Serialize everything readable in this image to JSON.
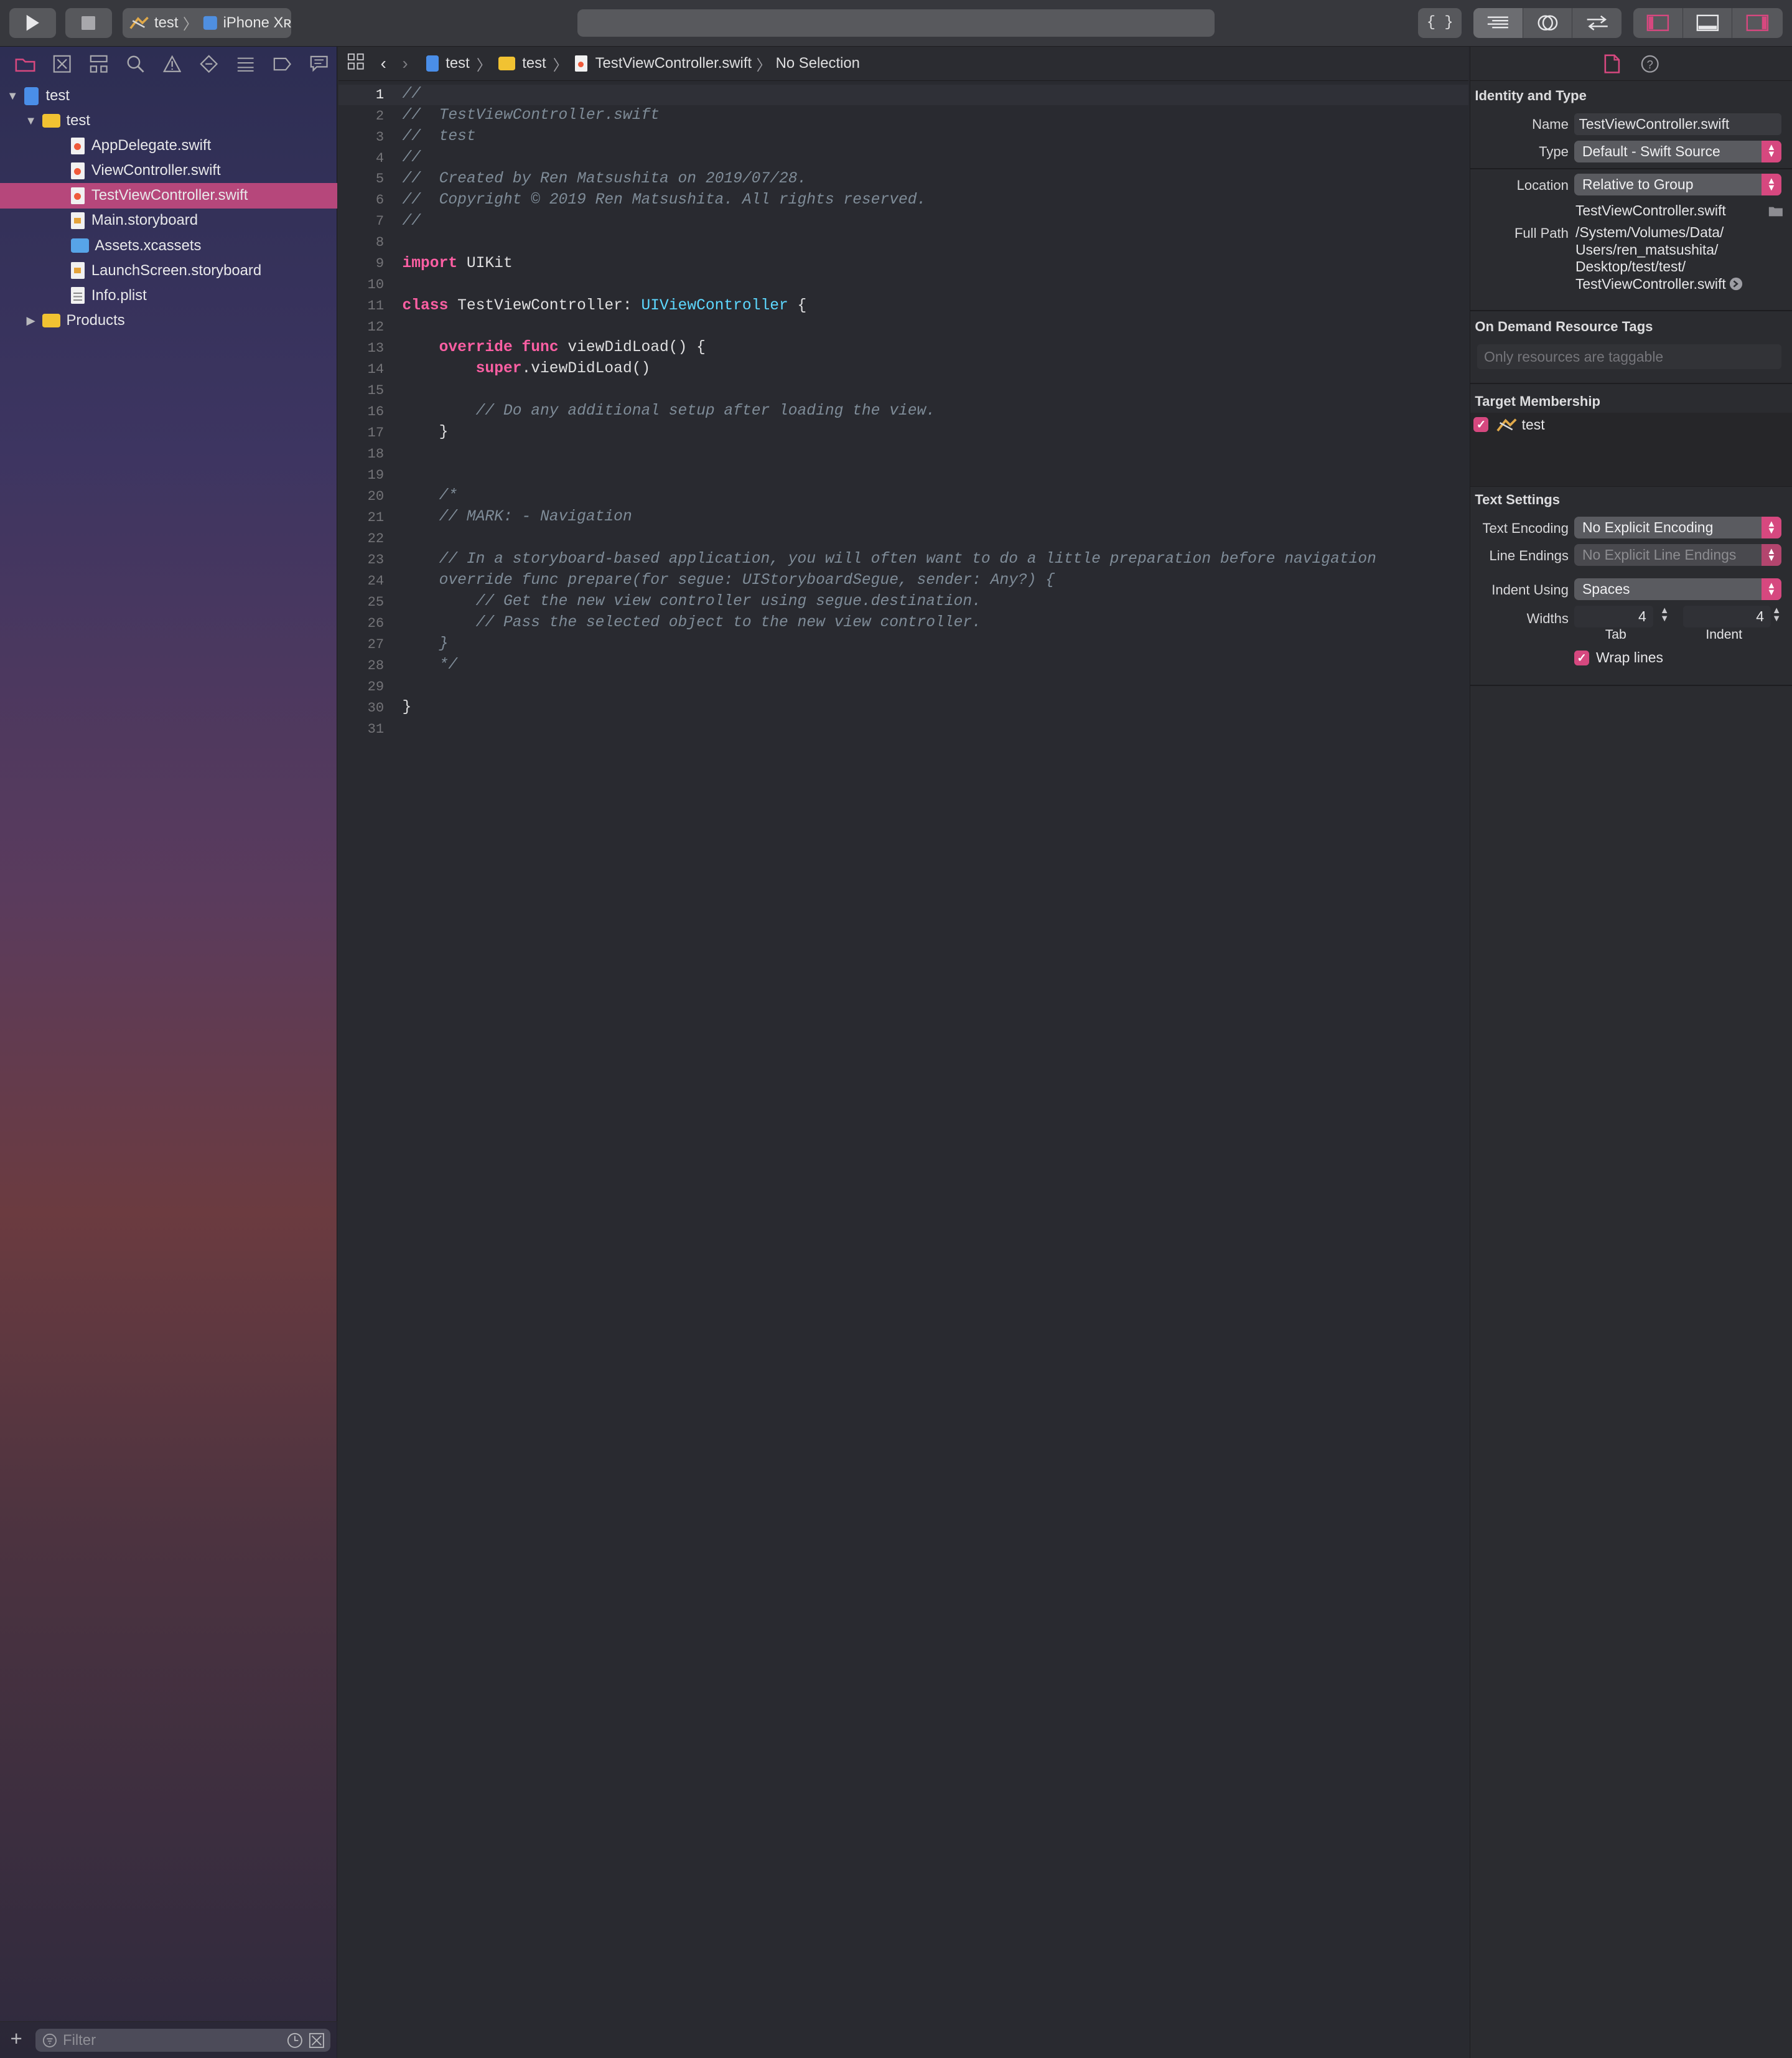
{
  "toolbar": {
    "scheme_target": "test",
    "scheme_device": "iPhone Xʀ"
  },
  "navigator": {
    "tree": [
      {
        "label": "test",
        "indent": 0,
        "kind": "project",
        "expanded": true
      },
      {
        "label": "test",
        "indent": 1,
        "kind": "folder",
        "expanded": true
      },
      {
        "label": "AppDelegate.swift",
        "indent": 2,
        "kind": "swift"
      },
      {
        "label": "ViewController.swift",
        "indent": 2,
        "kind": "swift"
      },
      {
        "label": "TestViewController.swift",
        "indent": 2,
        "kind": "swift",
        "selected": true
      },
      {
        "label": "Main.storyboard",
        "indent": 2,
        "kind": "storyboard"
      },
      {
        "label": "Assets.xcassets",
        "indent": 2,
        "kind": "assets"
      },
      {
        "label": "LaunchScreen.storyboard",
        "indent": 2,
        "kind": "storyboard"
      },
      {
        "label": "Info.plist",
        "indent": 2,
        "kind": "plist"
      },
      {
        "label": "Products",
        "indent": 1,
        "kind": "folder",
        "expanded": false
      }
    ],
    "filter_placeholder": "Filter"
  },
  "jumpbar": {
    "project": "test",
    "group": "test",
    "file": "TestViewController.swift",
    "selection": "No Selection"
  },
  "editor": {
    "current_line": 1,
    "lines": [
      [
        [
          "cm",
          "//"
        ]
      ],
      [
        [
          "cm",
          "//  TestViewController.swift"
        ]
      ],
      [
        [
          "cm",
          "//  test"
        ]
      ],
      [
        [
          "cm",
          "//"
        ]
      ],
      [
        [
          "cm",
          "//  Created by Ren Matsushita on 2019/07/28."
        ]
      ],
      [
        [
          "cm",
          "//  Copyright © 2019 Ren Matsushita. All rights reserved."
        ]
      ],
      [
        [
          "cm",
          "//"
        ]
      ],
      [],
      [
        [
          "kw",
          "import"
        ],
        [
          "pl",
          " UIKit"
        ]
      ],
      [],
      [
        [
          "kw",
          "class"
        ],
        [
          "pl",
          " TestViewController: "
        ],
        [
          "ty",
          "UIViewController"
        ],
        [
          "pl",
          " {"
        ]
      ],
      [],
      [
        [
          "pl",
          "    "
        ],
        [
          "kw",
          "override"
        ],
        [
          "pl",
          " "
        ],
        [
          "kw",
          "func"
        ],
        [
          "pl",
          " viewDidLoad() {"
        ]
      ],
      [
        [
          "pl",
          "        "
        ],
        [
          "kw",
          "super"
        ],
        [
          "pl",
          ".viewDidLoad()"
        ]
      ],
      [],
      [
        [
          "pl",
          "        "
        ],
        [
          "cm",
          "// Do any additional setup after loading the view."
        ]
      ],
      [
        [
          "pl",
          "    }"
        ]
      ],
      [],
      [],
      [
        [
          "pl",
          "    "
        ],
        [
          "cm",
          "/*"
        ]
      ],
      [
        [
          "pl",
          "    "
        ],
        [
          "cm",
          "// MARK: - Navigation"
        ]
      ],
      [],
      [
        [
          "pl",
          "    "
        ],
        [
          "cm",
          "// In a storyboard-based application, you will often want to do a little preparation before navigation"
        ]
      ],
      [
        [
          "pl",
          "    "
        ],
        [
          "cm",
          "override func prepare(for segue: UIStoryboardSegue, sender: Any?) {"
        ]
      ],
      [
        [
          "pl",
          "        "
        ],
        [
          "cm",
          "// Get the new view controller using segue.destination."
        ]
      ],
      [
        [
          "pl",
          "        "
        ],
        [
          "cm",
          "// Pass the selected object to the new view controller."
        ]
      ],
      [
        [
          "pl",
          "    "
        ],
        [
          "cm",
          "}"
        ]
      ],
      [
        [
          "pl",
          "    "
        ],
        [
          "cm",
          "*/"
        ]
      ],
      [],
      [
        [
          "pl",
          "}"
        ]
      ],
      []
    ]
  },
  "inspector": {
    "identity": {
      "title": "Identity and Type",
      "name_label": "Name",
      "name_value": "TestViewController.swift",
      "type_label": "Type",
      "type_value": "Default - Swift Source",
      "location_label": "Location",
      "location_value": "Relative to Group",
      "location_file": "TestViewController.swift",
      "fullpath_label": "Full Path",
      "fullpath_lines": [
        "/System/Volumes/Data/",
        "Users/ren_matsushita/",
        "Desktop/test/test/",
        "TestViewController.swift"
      ]
    },
    "tags": {
      "title": "On Demand Resource Tags",
      "placeholder": "Only resources are taggable"
    },
    "membership": {
      "title": "Target Membership",
      "target": "test",
      "checked": true
    },
    "text": {
      "title": "Text Settings",
      "encoding_label": "Text Encoding",
      "encoding_value": "No Explicit Encoding",
      "endings_label": "Line Endings",
      "endings_value": "No Explicit Line Endings",
      "indent_label": "Indent Using",
      "indent_value": "Spaces",
      "widths_label": "Widths",
      "tab_value": "4",
      "indent_width_value": "4",
      "tab_caption": "Tab",
      "indent_caption": "Indent",
      "wrap_label": "Wrap lines",
      "wrap_checked": true
    }
  },
  "colors": {
    "accent": "#d6487f",
    "selection": "#b6477b",
    "keyword": "#fc5fa3",
    "type": "#5dd8ff",
    "comment": "#7f8c98"
  }
}
